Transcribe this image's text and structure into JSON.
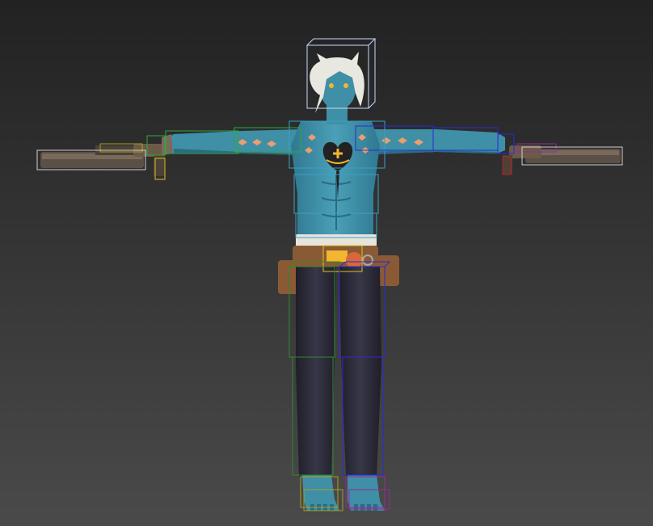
{
  "viewport": {
    "background_top": "#222222",
    "background_bottom": "#4a4a4a"
  },
  "character": {
    "skin": "#3f8fa6",
    "skin_shadow": "#2a6c82",
    "hair": "#e8e8e0",
    "pants": "#2b2a35",
    "belt": "#8a5a35",
    "belt_dark": "#5e3a22",
    "tattoo": "#e8a070",
    "chest_emblem": "#222222",
    "chest_emblem_accent": "#f2b630",
    "gun_body": "#5a5045"
  },
  "bone_boxes": {
    "head": "#c8d8ff",
    "spine": "#3aa0c8",
    "left_arm": "#2ea83a",
    "right_arm": "#2a2ad8",
    "left_leg": "#2e8a2e",
    "right_leg": "#2a2ad8",
    "feet_left": "#a8a020",
    "feet_right": "#9a2a9a",
    "hand_left": "#d8c020",
    "hand_right": "#c02020",
    "weapon": "#d0d0d0",
    "pelvis": "#e0c020"
  }
}
